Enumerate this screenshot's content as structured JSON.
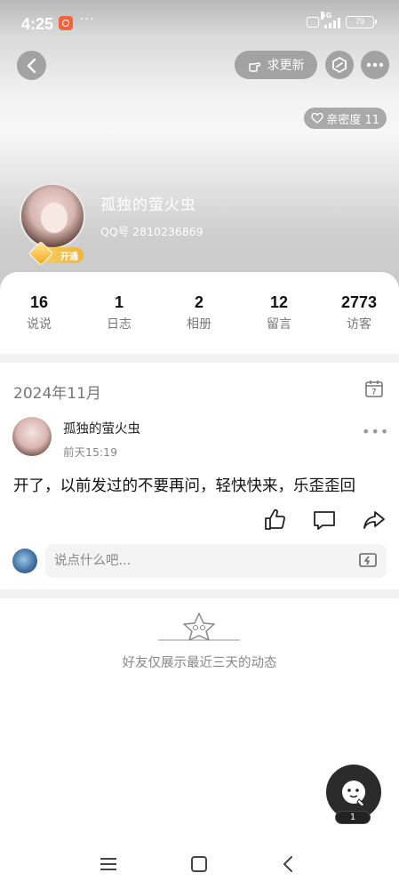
{
  "status_bar": {
    "time": "4:25",
    "network": "5G",
    "battery": "79"
  },
  "header": {
    "update_label": "求更新",
    "intimacy_label": "亲密度 11"
  },
  "profile": {
    "nickname": "孤独的萤火虫",
    "qq_number": "QQ号 2810236869",
    "vip_label": "开通"
  },
  "stats": [
    {
      "value": "16",
      "label": "说说"
    },
    {
      "value": "1",
      "label": "日志"
    },
    {
      "value": "2",
      "label": "相册"
    },
    {
      "value": "12",
      "label": "留言"
    },
    {
      "value": "2773",
      "label": "访客"
    }
  ],
  "feed": {
    "month": "2024年11月",
    "calendar_day": "7",
    "post": {
      "author": "孤独的萤火虫",
      "time": "前天15:19",
      "text": "开了，以前发过的不要再问，轻快快来，乐歪歪回"
    },
    "comment_placeholder": "说点什么吧...",
    "empty_notice": "好友仅展示最近三天的动态"
  },
  "floating": {
    "count": "1"
  },
  "icons": {
    "back": "chevron-left-icon",
    "update": "hand-point-icon",
    "shield": "hexagon-icon",
    "more": "more-dots-icon",
    "heart": "heart-icon",
    "calendar": "calendar-icon",
    "like": "thumbs-up-icon",
    "comment": "comment-icon",
    "share": "share-arrow-icon",
    "emoji": "emoji-keyboard-icon"
  },
  "colors": {
    "accent": "#f0b43d",
    "dark_button": "#2b2b2b",
    "muted_text": "#888888"
  }
}
